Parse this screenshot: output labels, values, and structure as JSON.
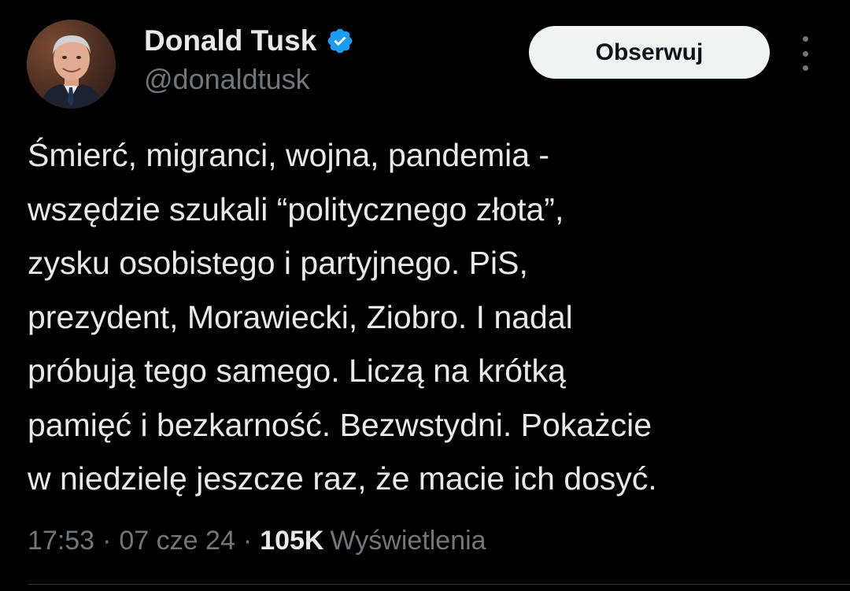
{
  "author": {
    "name": "Donald Tusk",
    "handle": "@donaldtusk",
    "verified": true
  },
  "actions": {
    "follow_label": "Obserwuj",
    "more_icon": "more-vertical-icon"
  },
  "tweet": {
    "lines": [
      "Śmierć, migranci, wojna, pandemia -",
      "wszędzie szukali “politycznego złota”,",
      "zysku osobistego i partyjnego. PiS,",
      "prezydent, Morawiecki, Ziobro. I nadal",
      "próbują tego samego. Liczą na krótką",
      "pamięć i bezkarność. Bezwstydni. Pokażcie",
      "w niedzielę jeszcze raz, że macie ich dosyć."
    ]
  },
  "meta": {
    "time": "17:53",
    "separator": "·",
    "date": "07 cze 24",
    "views_count": "105K",
    "views_label": "Wyświetlenia"
  },
  "colors": {
    "background": "#000000",
    "text_primary": "#e7e9ea",
    "text_secondary": "#71767b",
    "verified_blue": "#1d9bf0",
    "button_bg": "#eff3f4",
    "button_text": "#0f1419"
  }
}
